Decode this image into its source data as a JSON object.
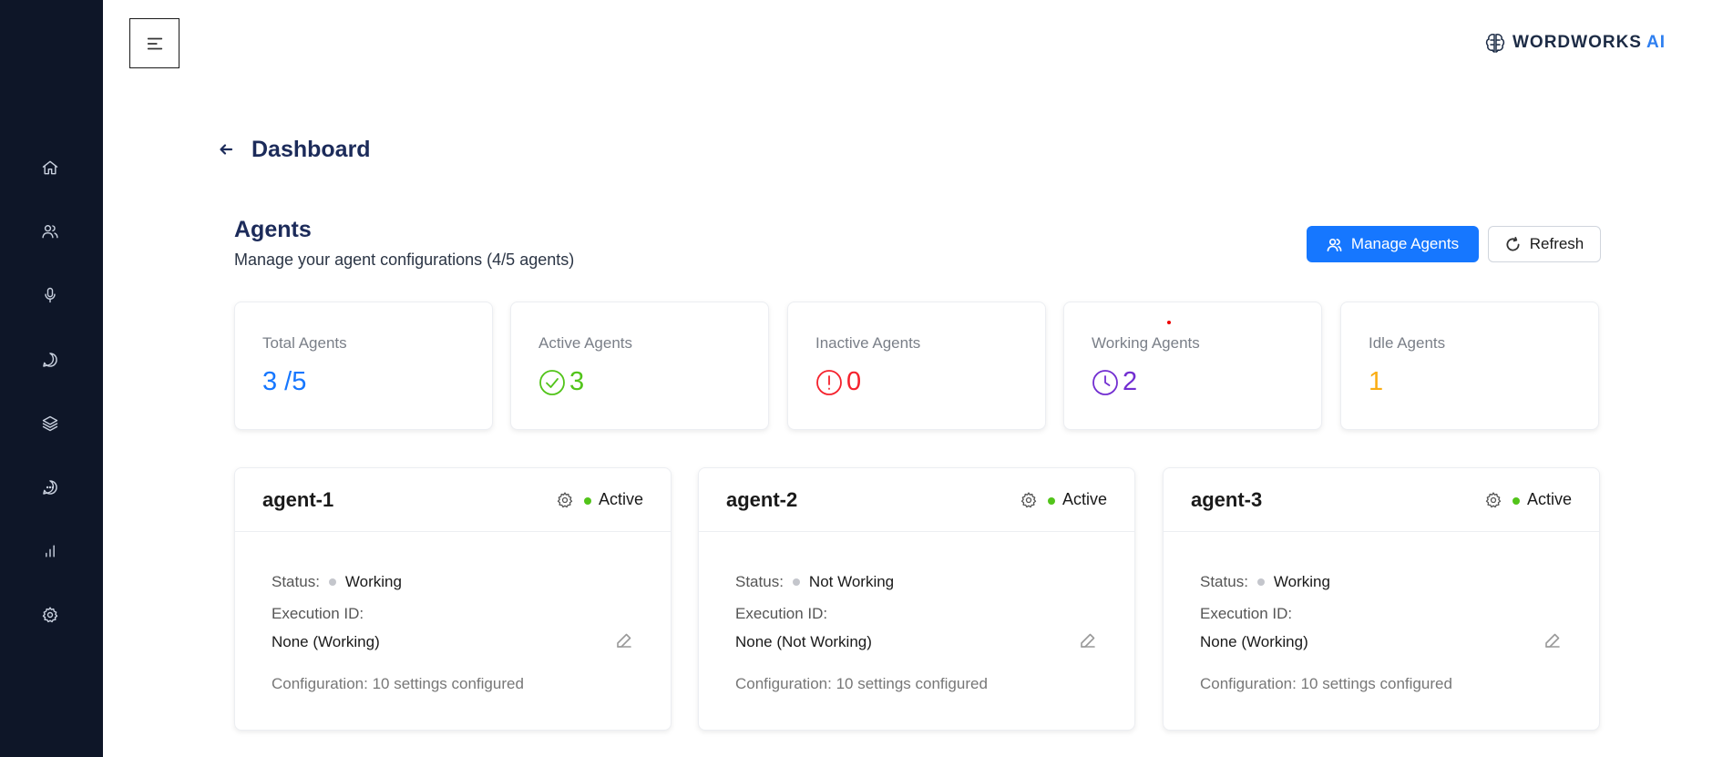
{
  "header": {
    "brand_main": "WORDWORKS",
    "brand_accent": "AI",
    "page_title": "Dashboard"
  },
  "sidebar": {
    "items": [
      {
        "name": "home-icon"
      },
      {
        "name": "users-icon"
      },
      {
        "name": "microphone-icon"
      },
      {
        "name": "chat-bubble-icon"
      },
      {
        "name": "layers-icon"
      },
      {
        "name": "message-dots-icon"
      },
      {
        "name": "bar-chart-icon"
      },
      {
        "name": "gear-icon"
      }
    ]
  },
  "section": {
    "title": "Agents",
    "subtitle": "Manage your agent configurations (4/5 agents)",
    "manage_label": "Manage Agents",
    "refresh_label": "Refresh"
  },
  "stats": [
    {
      "label": "Total Agents",
      "value": "3 /5",
      "color": "#1677ff",
      "icon": ""
    },
    {
      "label": "Active Agents",
      "value": "3",
      "color": "#52c41a",
      "icon": "check-circle-icon"
    },
    {
      "label": "Inactive Agents",
      "value": "0",
      "color": "#f5222d",
      "icon": "exclamation-circle-icon"
    },
    {
      "label": "Working Agents",
      "value": "2",
      "color": "#722ed1",
      "icon": "clock-icon"
    },
    {
      "label": "Idle Agents",
      "value": "1",
      "color": "#faad14",
      "icon": ""
    }
  ],
  "agents": [
    {
      "name": "agent-1",
      "state": "Active",
      "status_label": "Status:",
      "status": "Working",
      "exec_label": "Execution ID:",
      "exec_value": "None (Working)",
      "config": "Configuration: 10 settings configured"
    },
    {
      "name": "agent-2",
      "state": "Active",
      "status_label": "Status:",
      "status": "Not Working",
      "exec_label": "Execution ID:",
      "exec_value": "None (Not Working)",
      "config": "Configuration: 10 settings configured"
    },
    {
      "name": "agent-3",
      "state": "Active",
      "status_label": "Status:",
      "status": "Working",
      "exec_label": "Execution ID:",
      "exec_value": "None (Working)",
      "config": "Configuration: 10 settings configured"
    }
  ]
}
